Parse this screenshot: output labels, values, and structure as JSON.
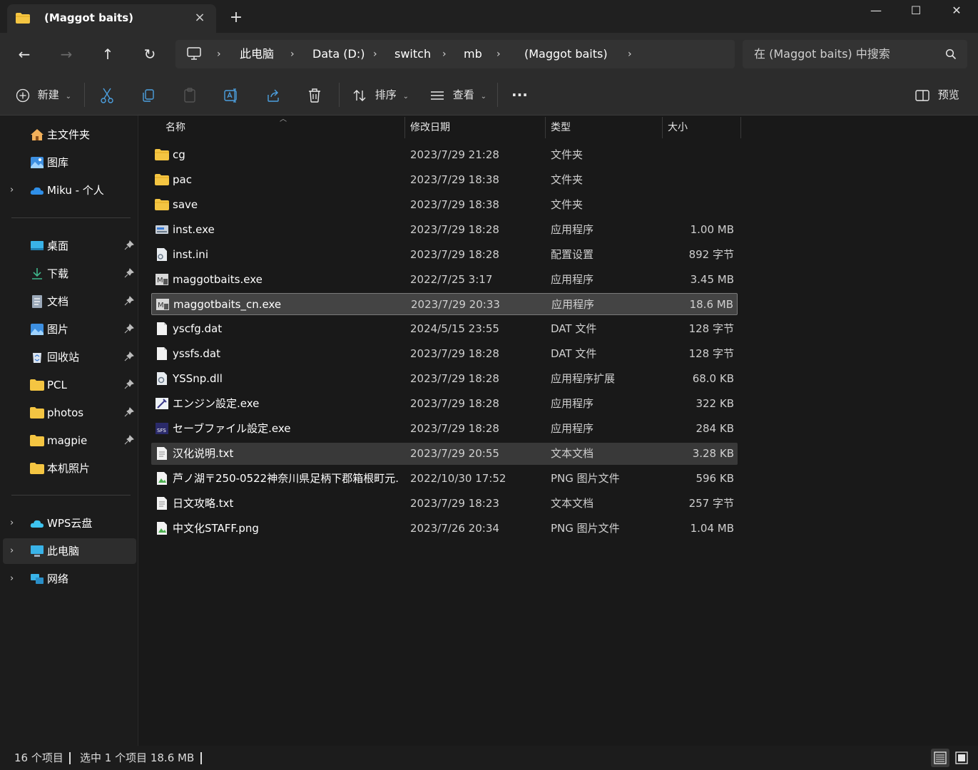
{
  "window": {
    "tab_title": "(Maggot baits)",
    "tab_close_icon": "×",
    "new_tab_icon": "+",
    "minimize_icon": "—",
    "maximize_icon": "☐",
    "close_icon": "✕"
  },
  "nav": {
    "back_icon": "←",
    "forward_icon": "→",
    "up_icon": "↑",
    "refresh_icon": "↻"
  },
  "breadcrumb": [
    "此电脑",
    "Data (D:)",
    "switch",
    "mb",
    "(Maggot baits)"
  ],
  "search": {
    "placeholder": "在 (Maggot baits) 中搜索"
  },
  "toolbar": {
    "new_label": "新建",
    "sort_label": "排序",
    "view_label": "查看",
    "more_label": "···",
    "preview_label": "预览"
  },
  "sidebar": {
    "quick": [
      {
        "label": "主文件夹",
        "icon": "home-icon"
      },
      {
        "label": "图库",
        "icon": "gallery-icon"
      },
      {
        "label": "Miku - 个人",
        "icon": "onedrive-icon",
        "expandable": true
      }
    ],
    "pinned": [
      {
        "label": "桌面",
        "icon": "desktop-icon"
      },
      {
        "label": "下载",
        "icon": "download-icon"
      },
      {
        "label": "文档",
        "icon": "documents-icon"
      },
      {
        "label": "图片",
        "icon": "pictures-icon"
      },
      {
        "label": "回收站",
        "icon": "recycle-bin-icon"
      },
      {
        "label": "PCL",
        "icon": "folder-icon"
      },
      {
        "label": "photos",
        "icon": "folder-icon"
      },
      {
        "label": "magpie",
        "icon": "folder-icon"
      },
      {
        "label": "本机照片",
        "icon": "folder-icon"
      }
    ],
    "drives": [
      {
        "label": "WPS云盘",
        "icon": "cloud-icon"
      },
      {
        "label": "此电脑",
        "icon": "this-pc-icon"
      },
      {
        "label": "网络",
        "icon": "network-icon"
      }
    ]
  },
  "columns": {
    "name": "名称",
    "date": "修改日期",
    "type": "类型",
    "size": "大小"
  },
  "files": [
    {
      "name": "cg",
      "date": "2023/7/29 21:28",
      "type": "文件夹",
      "size": "",
      "icon": "folder-icon"
    },
    {
      "name": "pac",
      "date": "2023/7/29 18:38",
      "type": "文件夹",
      "size": "",
      "icon": "folder-icon"
    },
    {
      "name": "save",
      "date": "2023/7/29 18:38",
      "type": "文件夹",
      "size": "",
      "icon": "folder-icon"
    },
    {
      "name": "inst.exe",
      "date": "2023/7/29 18:28",
      "type": "应用程序",
      "size": "1.00 MB",
      "icon": "installer-icon"
    },
    {
      "name": "inst.ini",
      "date": "2023/7/29 18:28",
      "type": "配置设置",
      "size": "892 字节",
      "icon": "config-file-icon"
    },
    {
      "name": "maggotbaits.exe",
      "date": "2022/7/25 3:17",
      "type": "应用程序",
      "size": "3.45 MB",
      "icon": "app-icon"
    },
    {
      "name": "maggotbaits_cn.exe",
      "date": "2023/7/29 20:33",
      "type": "应用程序",
      "size": "18.6 MB",
      "icon": "app-icon"
    },
    {
      "name": "yscfg.dat",
      "date": "2024/5/15 23:55",
      "type": "DAT 文件",
      "size": "128 字节",
      "icon": "file-icon"
    },
    {
      "name": "yssfs.dat",
      "date": "2023/7/29 18:28",
      "type": "DAT 文件",
      "size": "128 字节",
      "icon": "file-icon"
    },
    {
      "name": "YSSnp.dll",
      "date": "2023/7/29 18:28",
      "type": "应用程序扩展",
      "size": "68.0 KB",
      "icon": "dll-icon"
    },
    {
      "name": "エンジン設定.exe",
      "date": "2023/7/29 18:28",
      "type": "应用程序",
      "size": "322 KB",
      "icon": "settings-app-icon"
    },
    {
      "name": "セーブファイル設定.exe",
      "date": "2023/7/29 18:28",
      "type": "应用程序",
      "size": "284 KB",
      "icon": "save-settings-app-icon"
    },
    {
      "name": "汉化说明.txt",
      "date": "2023/7/29 20:55",
      "type": "文本文档",
      "size": "3.28 KB",
      "icon": "text-file-icon"
    },
    {
      "name": "芦ノ湖〒250-0522神奈川県足柄下郡箱根町元...",
      "date": "2022/10/30 17:52",
      "type": "PNG 图片文件",
      "size": "596 KB",
      "icon": "image-file-icon"
    },
    {
      "name": "日文攻略.txt",
      "date": "2023/7/29 18:23",
      "type": "文本文档",
      "size": "257 字节",
      "icon": "text-file-icon"
    },
    {
      "name": "中文化STAFF.png",
      "date": "2023/7/26 20:34",
      "type": "PNG 图片文件",
      "size": "1.04 MB",
      "icon": "image-file-icon"
    }
  ],
  "selected_index": 6,
  "hover_index": 12,
  "status": {
    "count": "16 个项目",
    "selection": "选中 1 个项目  18.6 MB"
  },
  "colors": {
    "folder": "#f4c542",
    "accent": "#4ca0e0",
    "background": "#191919",
    "selected_row": "#444444"
  }
}
